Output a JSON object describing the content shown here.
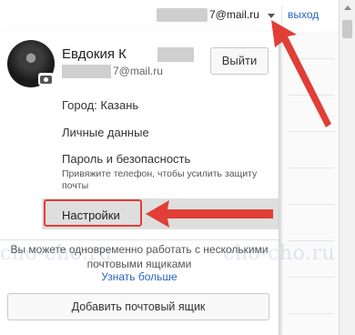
{
  "topbar": {
    "email_suffix": "7@mail.ru",
    "exit_label": "выход"
  },
  "account": {
    "name": "Евдокия К",
    "login_suffix": "7@mail.ru",
    "logout_label": "Выйти"
  },
  "menu": {
    "city": "Город: Казань",
    "personal": "Личные данные",
    "password": "Пароль и безопасность",
    "password_hint": "Привяжите телефон, чтобы усилить защиту почты",
    "settings": "Настройки"
  },
  "multi": {
    "text": "Вы можете одновременно работать с несколькими почтовыми ящиками",
    "learn_more": "Узнать больше",
    "add_mailbox": "Добавить почтовый ящик"
  },
  "watermark": "cho-cho.ru",
  "colors": {
    "link": "#2a64c5",
    "annotation": "#e03e36",
    "settings_bg": "#dedede"
  }
}
